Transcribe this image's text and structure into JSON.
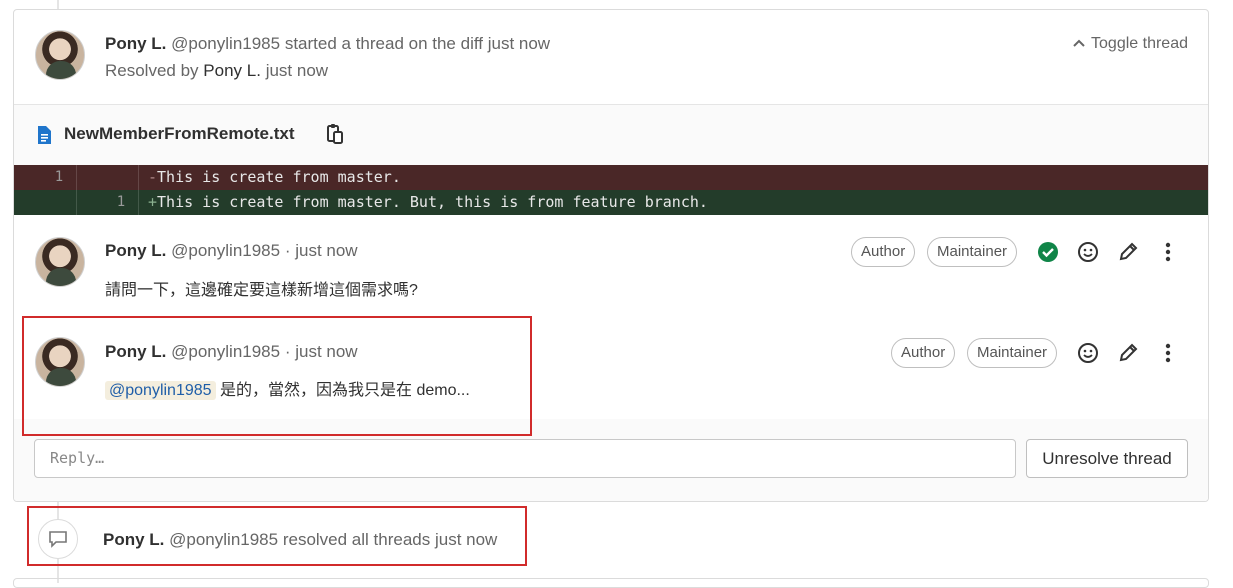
{
  "thread": {
    "header": {
      "author_name": "Pony L.",
      "author_handle": "@ponylin1985",
      "action_text": "started a thread on the diff just now",
      "resolved_prefix": "Resolved by",
      "resolved_by": "Pony L.",
      "resolved_time": "just now",
      "toggle_label": "Toggle thread"
    },
    "file": {
      "name": "NewMemberFromRemote.txt",
      "icon": "file-text-icon",
      "copy_icon": "copy-to-clipboard-icon"
    },
    "diff": {
      "removed": {
        "old_line": "1",
        "new_line": "",
        "sign": "-",
        "text": "This is create from master."
      },
      "added": {
        "old_line": "",
        "new_line": "1",
        "sign": "+",
        "text": "This is create from master. But, this is from feature branch."
      }
    },
    "notes": [
      {
        "author_name": "Pony L.",
        "author_handle": "@ponylin1985",
        "time": "· just now",
        "body": "請問一下，這邊確定要這樣新增這個需求嗎?",
        "badges": [
          "Author",
          "Maintainer"
        ],
        "resolved": true
      },
      {
        "author_name": "Pony L.",
        "author_handle": "@ponylin1985",
        "time": "· just now",
        "mention": "@ponylin1985",
        "body": "是的，當然，因為我只是在 demo...",
        "badges": [
          "Author",
          "Maintainer"
        ]
      }
    ],
    "reply": {
      "placeholder": "Reply…",
      "unresolve_label": "Unresolve thread"
    }
  },
  "system_note": {
    "author_name": "Pony L.",
    "author_handle": "@ponylin1985",
    "text": "resolved all threads just now",
    "icon": "comment-icon"
  },
  "colors": {
    "removed_bg": "#4a2727",
    "added_bg": "#233c2a",
    "resolved_green": "#108548",
    "highlight_red": "#d12b2b"
  }
}
